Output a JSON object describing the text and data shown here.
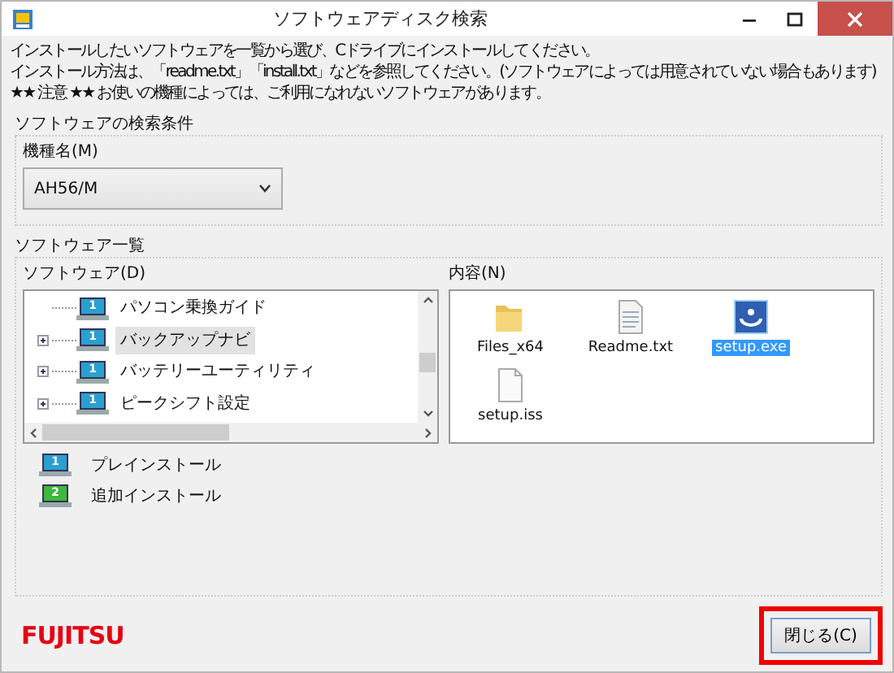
{
  "window": {
    "title": "ソフトウェアディスク検索"
  },
  "intro": [
    "インストールしたいソフトウェアを一覧から選び、Cドライブにインストールしてください。",
    "インストール方法は、「readme.txt」「install.txt」などを参照してください。(ソフトウェアによっては用意されていない場合もあります)",
    "★★ 注意 ★★ お使いの機種によっては、ご利用になれないソフトウェアがあります。"
  ],
  "search_group": {
    "title": "ソフトウェアの検索条件",
    "model_label": "機種名(M)",
    "model_value": "AH56/M"
  },
  "list_group": {
    "title": "ソフトウェア一覧",
    "tree_label": "ソフトウェア(D)",
    "tree": [
      {
        "label": "パソコン乗換ガイド",
        "badge": "1",
        "expandable": false,
        "selected": false
      },
      {
        "label": "バックアップナビ",
        "badge": "1",
        "expandable": true,
        "selected": true
      },
      {
        "label": "バッテリーユーティリティ",
        "badge": "1",
        "expandable": true,
        "selected": false
      },
      {
        "label": "ピークシフト設定",
        "badge": "1",
        "expandable": true,
        "selected": false
      }
    ],
    "contents_label": "内容(N)",
    "files": [
      {
        "name": "Files_x64",
        "kind": "folder",
        "selected": false
      },
      {
        "name": "Readme.txt",
        "kind": "text",
        "selected": false
      },
      {
        "name": "setup.exe",
        "kind": "exe",
        "selected": true
      },
      {
        "name": "setup.iss",
        "kind": "file",
        "selected": false
      }
    ],
    "legend": [
      {
        "badge": "1",
        "label": "プレインストール",
        "color": "#2a9fd0"
      },
      {
        "badge": "2",
        "label": "追加インストール",
        "color": "#3cb83c"
      }
    ]
  },
  "footer": {
    "logo": "FUJITSU",
    "close_button": {
      "label": "閉じる(C)",
      "highlighted": true
    }
  }
}
